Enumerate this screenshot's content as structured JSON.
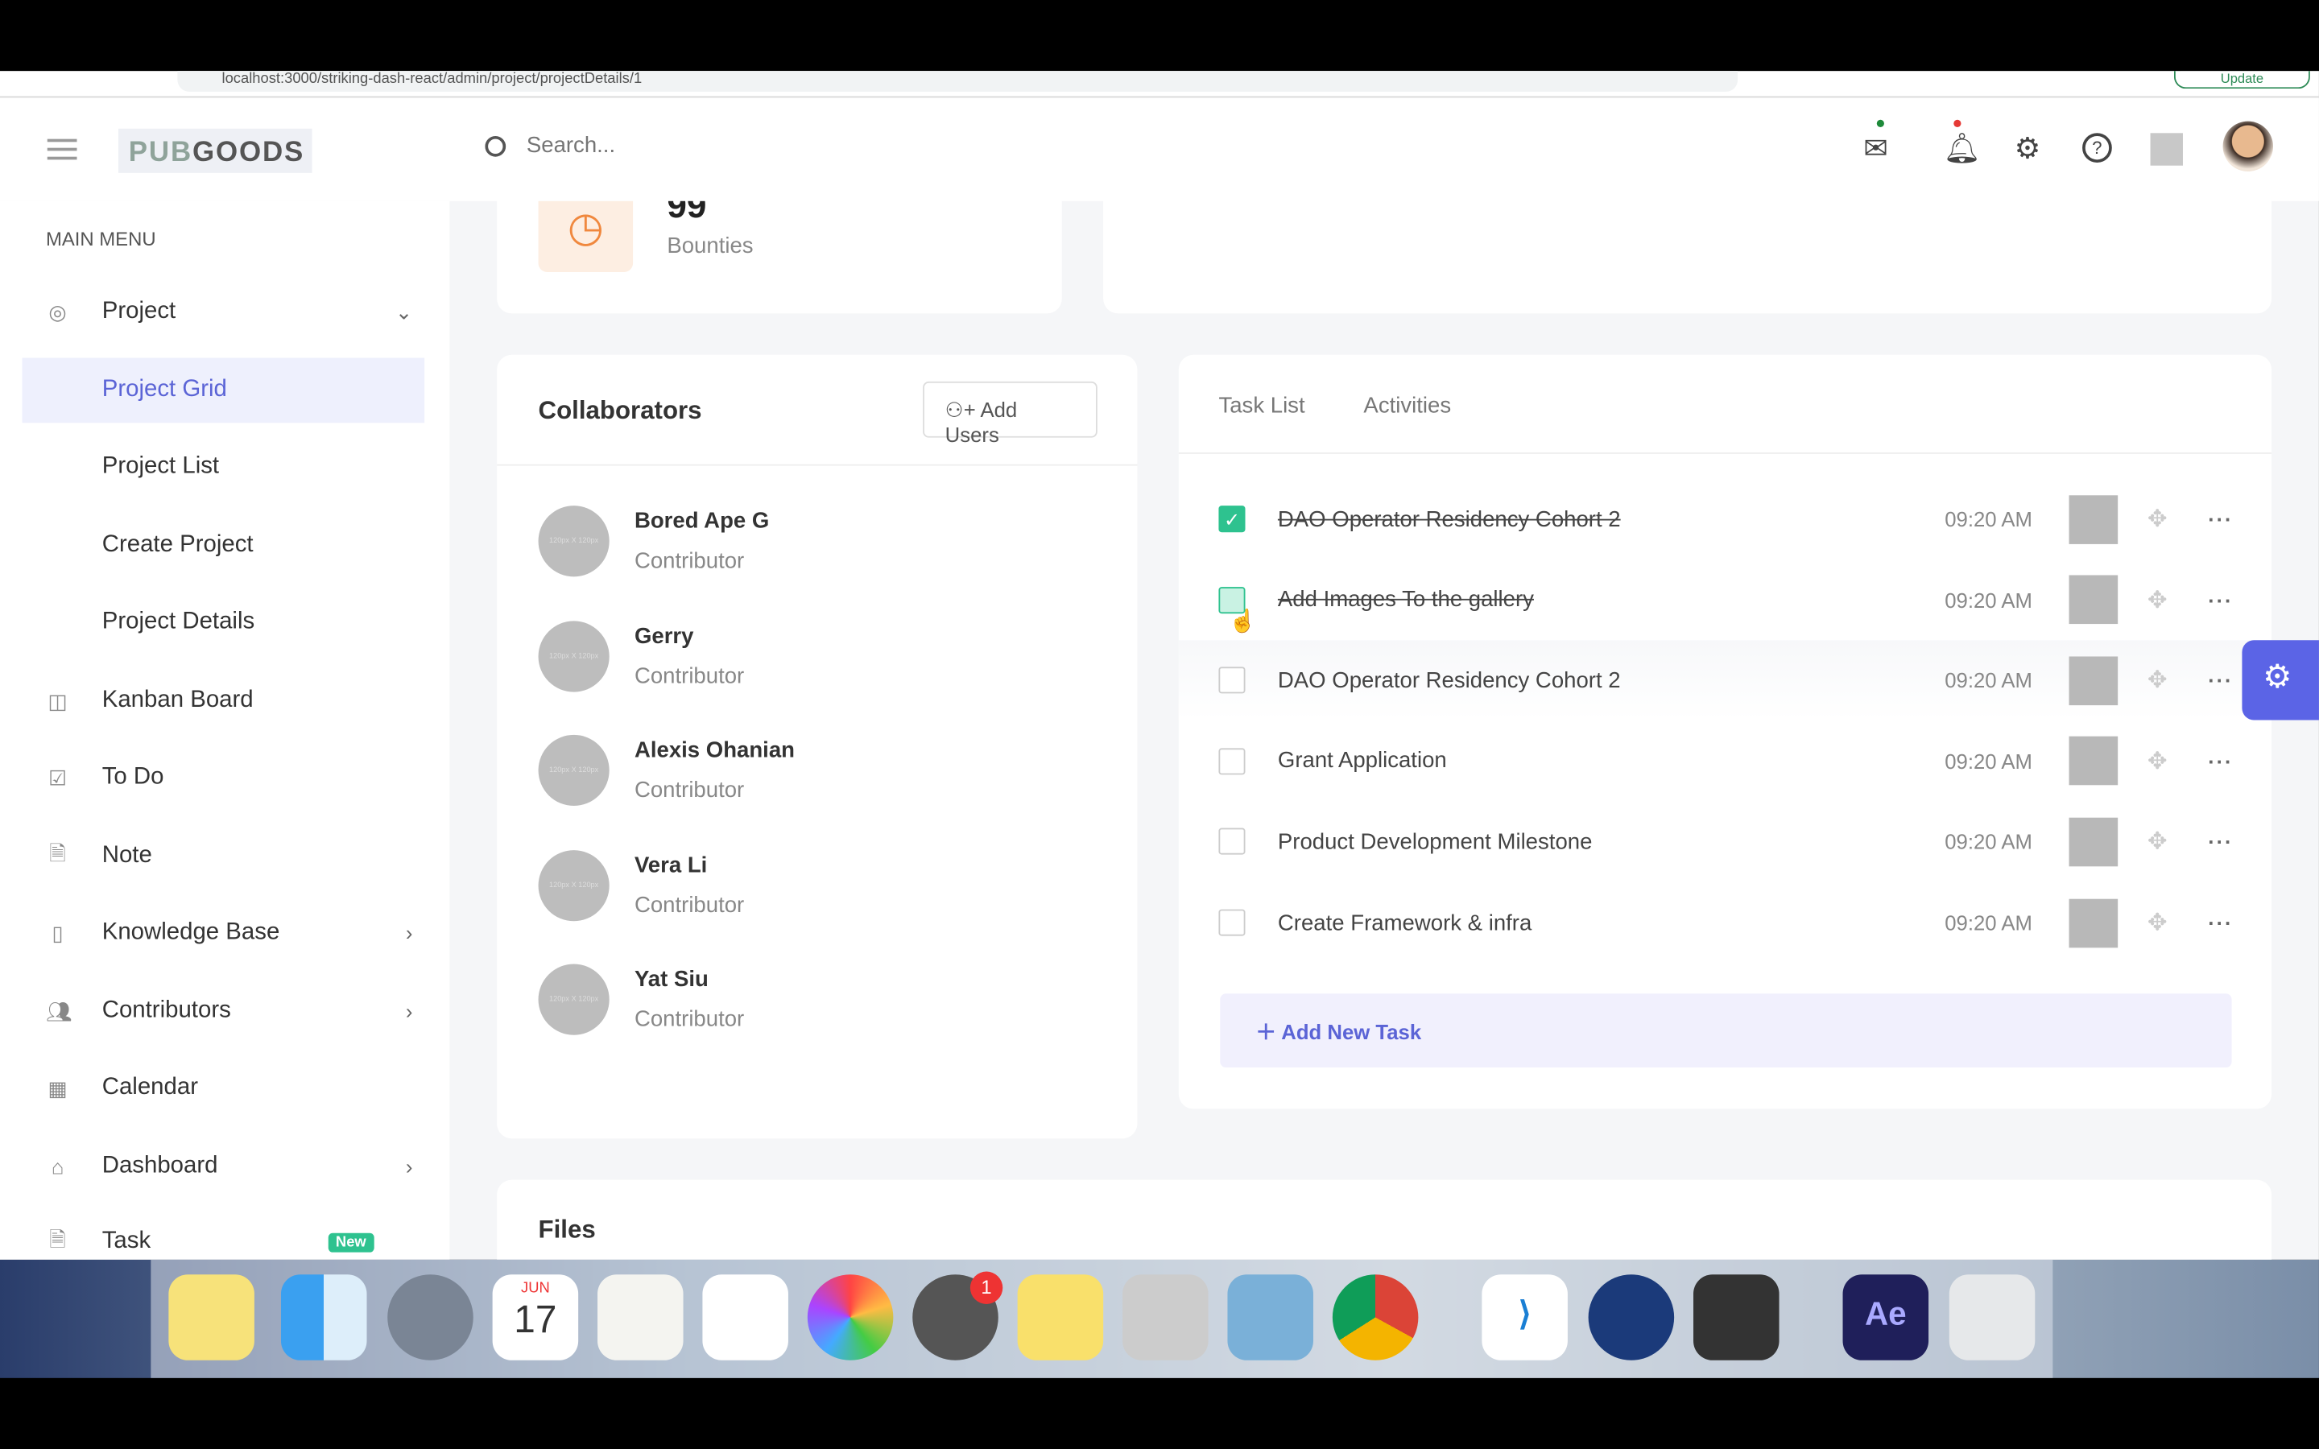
{
  "browser": {
    "url": "localhost:3000/striking-dash-react/admin/project/projectDetails/1",
    "update_label": "Update"
  },
  "header": {
    "logo_a": "PUB",
    "logo_b": "GOODS",
    "search_placeholder": "Search...",
    "mail_dot_color": "#1e8a3a",
    "bell_dot_color": "#e53935"
  },
  "sidebar": {
    "section": "MAIN MENU",
    "items": [
      {
        "label": "Project",
        "icon": "target-icon",
        "chevron": "down"
      },
      {
        "label": "Project Grid",
        "active": true
      },
      {
        "label": "Project List"
      },
      {
        "label": "Create Project"
      },
      {
        "label": "Project Details"
      },
      {
        "label": "Kanban Board",
        "icon": "columns-icon"
      },
      {
        "label": "To Do",
        "icon": "checkbox-icon"
      },
      {
        "label": "Note",
        "icon": "file-icon"
      },
      {
        "label": "Knowledge Base",
        "icon": "book-icon",
        "chevron": "right"
      },
      {
        "label": "Contributors",
        "icon": "users-icon",
        "chevron": "right"
      },
      {
        "label": "Calendar",
        "icon": "calendar-icon"
      },
      {
        "label": "Dashboard",
        "icon": "home-icon",
        "chevron": "right"
      },
      {
        "label": "Task",
        "icon": "file-icon",
        "badge": "New"
      }
    ]
  },
  "stats": {
    "value": "99",
    "label": "Bounties"
  },
  "collaborators": {
    "title": "Collaborators",
    "add_label": "Add Users",
    "avatar_placeholder": "120px X 120px",
    "people": [
      {
        "name": "Bored Ape G",
        "role": "Contributor"
      },
      {
        "name": "Gerry",
        "role": "Contributor"
      },
      {
        "name": "Alexis Ohanian",
        "role": "Contributor"
      },
      {
        "name": "Vera Li",
        "role": "Contributor"
      },
      {
        "name": "Yat Siu",
        "role": "Contributor"
      }
    ]
  },
  "tasks": {
    "tabs": [
      "Task List",
      "Activities"
    ],
    "add_label": "Add New Task",
    "items": [
      {
        "name": "DAO Operator Residency Cohort 2",
        "time": "09:20 AM",
        "checked": true,
        "done": true
      },
      {
        "name": "Add Images To the gallery",
        "time": "09:20 AM",
        "checked": false,
        "done": true
      },
      {
        "name": "DAO Operator Residency Cohort 2",
        "time": "09:20 AM",
        "checked": false,
        "done": false
      },
      {
        "name": "Grant Application",
        "time": "09:20 AM",
        "checked": false,
        "done": false
      },
      {
        "name": "Product Development Milestone",
        "time": "09:20 AM",
        "checked": false,
        "done": false
      },
      {
        "name": "Create Framework & infra",
        "time": "09:20 AM",
        "checked": false,
        "done": false
      }
    ]
  },
  "files": {
    "title": "Files"
  },
  "dock": {
    "calendar_month": "JUN",
    "calendar_day": "17",
    "settings_badge": "1",
    "ae_label": "Ae"
  },
  "colors": {
    "accent": "#5b64e6",
    "success": "#2ec28f"
  }
}
